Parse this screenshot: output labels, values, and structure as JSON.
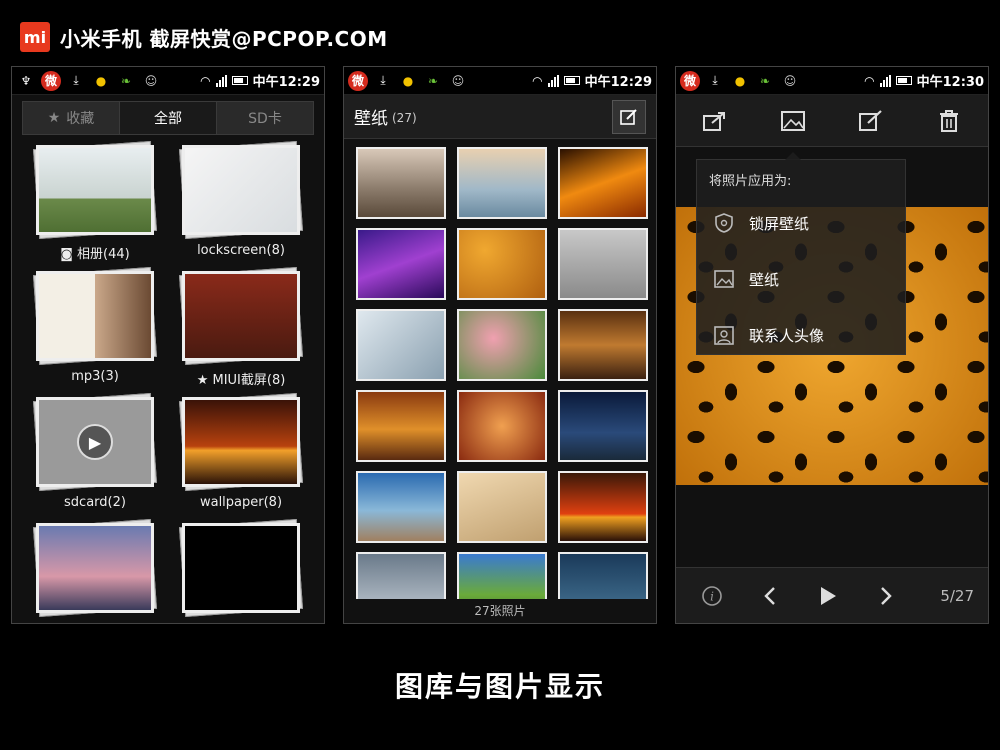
{
  "header": {
    "logo": "mi",
    "title": "小米手机 截屏快赏@PCPOP.COM"
  },
  "caption": "图库与图片显示",
  "status_bars": [
    {
      "time": "中午12:29"
    },
    {
      "time": "中午12:29"
    },
    {
      "time": "中午12:30"
    }
  ],
  "panel1": {
    "tabs": [
      {
        "label": "收藏",
        "icon": "star-icon"
      },
      {
        "label": "全部"
      },
      {
        "label": "SD卡"
      }
    ],
    "albums": [
      {
        "label": "相册(44)",
        "icon": "camera-icon"
      },
      {
        "label": "lockscreen(8)"
      },
      {
        "label": "mp3(3)"
      },
      {
        "label": "MIUI截屏(8)",
        "icon": "star-icon"
      },
      {
        "label": "sdcard(2)"
      },
      {
        "label": "wallpaper(8)"
      },
      {
        "label": ""
      },
      {
        "label": ""
      }
    ]
  },
  "panel2": {
    "title": "壁纸",
    "count": "(27)",
    "footer": "27张照片"
  },
  "panel3": {
    "menu": {
      "title": "将照片应用为:",
      "items": [
        {
          "label": "锁屏壁纸",
          "icon": "lock-screen-icon"
        },
        {
          "label": "壁纸",
          "icon": "image-icon"
        },
        {
          "label": "联系人头像",
          "icon": "contact-icon"
        }
      ]
    },
    "page_indicator": "5/27"
  },
  "colors": {
    "accent": "#e8391e",
    "background": "#000000"
  }
}
